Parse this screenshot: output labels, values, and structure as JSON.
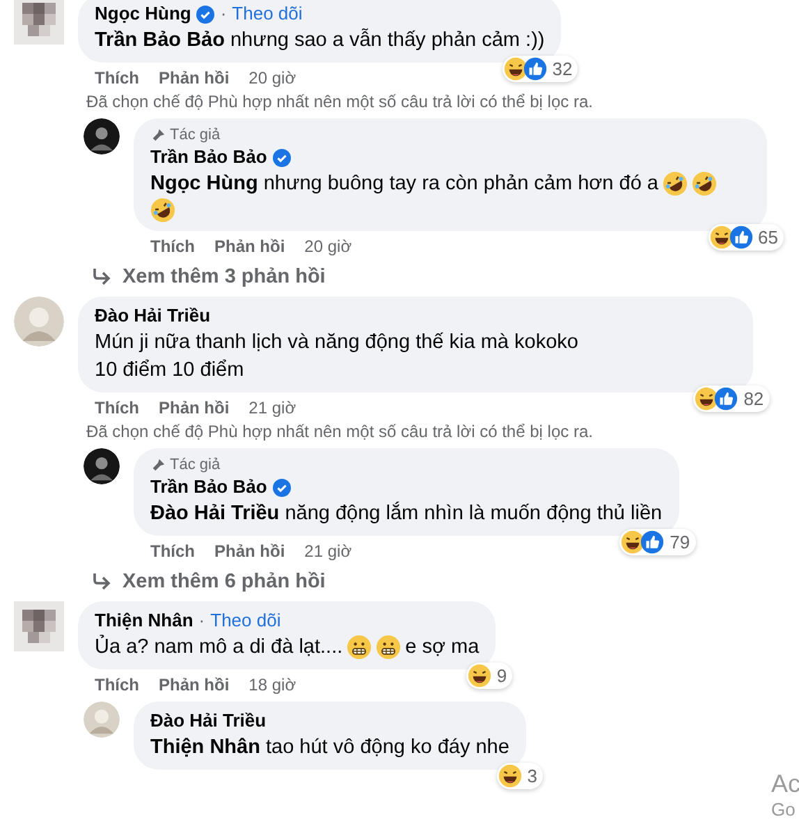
{
  "comments": [
    {
      "avatar": {
        "kind": "pixelated"
      },
      "name": "Ngọc Hùng",
      "verified": true,
      "separator": "·",
      "follow": "Theo dõi",
      "body": [
        {
          "kind": "text",
          "text": "**Trần Bảo Bảo** nhưng sao a vẫn thấy phản cảm :))"
        }
      ],
      "reactions": {
        "kinds": [
          {
            "kind": "haha"
          },
          {
            "kind": "like"
          }
        ],
        "count": "32"
      },
      "actions": [
        "Thích",
        "Phản hồi"
      ],
      "time": "20 giờ",
      "notice": "Đã chọn chế độ Phù hợp nhất nên một số câu trả lời có thể bị lọc ra.",
      "replies": [
        {
          "avatar": {
            "kind": "dark"
          },
          "badge": "Tác giả",
          "name": "Trần Bảo Bảo",
          "verified": true,
          "body": [
            {
              "kind": "text",
              "text": "**Ngọc Hùng** nhưng buông tay ra còn phản cảm hơn đó a"
            },
            {
              "kind": "rofl"
            },
            {
              "kind": "rofl"
            },
            {
              "kind": "break"
            },
            {
              "kind": "rofl"
            }
          ],
          "reactions": {
            "kinds": [
              {
                "kind": "haha"
              },
              {
                "kind": "like"
              }
            ],
            "count": "65"
          },
          "actions": [
            "Thích",
            "Phản hồi"
          ],
          "time": "20 giờ"
        }
      ],
      "see_more": "Xem thêm 3 phản hồi"
    },
    {
      "avatar": {
        "kind": "light"
      },
      "name": "Đào Hải Triều",
      "verified": false,
      "body": [
        {
          "kind": "text",
          "text": "Mún ji nữa thanh lịch và năng động thế kia mà kokoko"
        },
        {
          "kind": "break"
        },
        {
          "kind": "text",
          "text": "10 điểm 10 điểm"
        }
      ],
      "reactions": {
        "kinds": [
          {
            "kind": "haha"
          },
          {
            "kind": "like"
          }
        ],
        "count": "82"
      },
      "actions": [
        "Thích",
        "Phản hồi"
      ],
      "time": "21 giờ",
      "notice": "Đã chọn chế độ Phù hợp nhất nên một số câu trả lời có thể bị lọc ra.",
      "replies": [
        {
          "avatar": {
            "kind": "dark"
          },
          "badge": "Tác giả",
          "name": "Trần Bảo Bảo",
          "verified": true,
          "body": [
            {
              "kind": "text",
              "text": "**Đào Hải Triều** năng động lắm nhìn là muốn động thủ liền"
            }
          ],
          "reactions": {
            "kinds": [
              {
                "kind": "haha"
              },
              {
                "kind": "like"
              }
            ],
            "count": "79"
          },
          "actions": [
            "Thích",
            "Phản hồi"
          ],
          "time": "21 giờ"
        }
      ],
      "see_more": "Xem thêm 6 phản hồi"
    },
    {
      "avatar": {
        "kind": "pixelated"
      },
      "name": "Thiện Nhân",
      "verified": false,
      "separator": "·",
      "follow": "Theo dõi",
      "body": [
        {
          "kind": "text",
          "text": "Ủa a? nam mô a di đà lạt...."
        },
        {
          "kind": "grimace"
        },
        {
          "kind": "grimace"
        },
        {
          "kind": "text",
          "text": "e sợ ma"
        }
      ],
      "reactions": {
        "kinds": [
          {
            "kind": "haha"
          }
        ],
        "count": "9"
      },
      "actions": [
        "Thích",
        "Phản hồi"
      ],
      "time": "18 giờ",
      "replies": [
        {
          "avatar": {
            "kind": "light"
          },
          "name": "Đào Hải Triều",
          "verified": false,
          "body": [
            {
              "kind": "text",
              "text": "**Thiện Nhân** tao hút vô động ko đáy nhe"
            }
          ],
          "reactions": {
            "kinds": [
              {
                "kind": "haha"
              }
            ],
            "count": "3"
          }
        }
      ]
    }
  ],
  "os_overlay": [
    "Ac",
    "Go"
  ]
}
